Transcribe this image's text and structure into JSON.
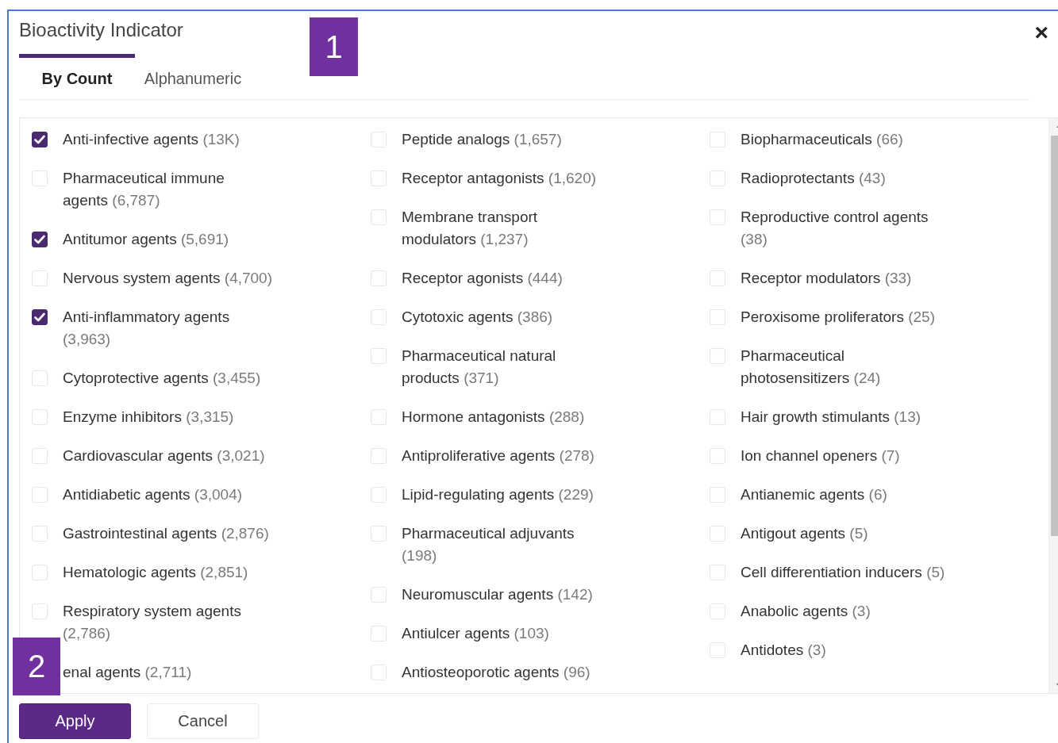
{
  "dialog": {
    "title": "Bioactivity Indicator",
    "close": "×"
  },
  "tabs": [
    {
      "label": "By Count",
      "selected": true
    },
    {
      "label": "Alphanumeric",
      "selected": false
    }
  ],
  "columns": [
    [
      {
        "name": "Anti-infective agents",
        "count": "(13K)",
        "checked": true
      },
      {
        "name": "Pharmaceutical immune agents",
        "count": "(6,787)",
        "checked": false
      },
      {
        "name": "Antitumor agents",
        "count": "(5,691)",
        "checked": true
      },
      {
        "name": "Nervous system agents",
        "count": "(4,700)",
        "checked": false
      },
      {
        "name": "Anti-inflammatory agents",
        "count": "(3,963)",
        "checked": true
      },
      {
        "name": "Cytoprotective agents",
        "count": "(3,455)",
        "checked": false
      },
      {
        "name": "Enzyme inhibitors",
        "count": "(3,315)",
        "checked": false
      },
      {
        "name": "Cardiovascular agents",
        "count": "(3,021)",
        "checked": false
      },
      {
        "name": "Antidiabetic agents",
        "count": "(3,004)",
        "checked": false
      },
      {
        "name": "Gastrointestinal agents",
        "count": "(2,876)",
        "checked": false
      },
      {
        "name": "Hematologic agents",
        "count": "(2,851)",
        "checked": false
      },
      {
        "name": "Respiratory system agents",
        "count": "(2,786)",
        "checked": false
      },
      {
        "name": "enal agents",
        "count": "(2,711)"
      }
    ],
    [
      {
        "name": "Peptide analogs",
        "count": "(1,657)",
        "checked": false
      },
      {
        "name": "Receptor antagonists",
        "count": "(1,620)",
        "checked": false
      },
      {
        "name": "Membrane transport modulators",
        "count": "(1,237)",
        "checked": false
      },
      {
        "name": "Receptor agonists",
        "count": "(444)",
        "checked": false
      },
      {
        "name": "Cytotoxic agents",
        "count": "(386)",
        "checked": false
      },
      {
        "name": "Pharmaceutical natural products",
        "count": "(371)",
        "checked": false
      },
      {
        "name": "Hormone antagonists",
        "count": "(288)",
        "checked": false
      },
      {
        "name": "Antiproliferative agents",
        "count": "(278)",
        "checked": false
      },
      {
        "name": "Lipid-regulating agents",
        "count": "(229)",
        "checked": false
      },
      {
        "name": "Pharmaceutical adjuvants",
        "count": "(198)",
        "checked": false
      },
      {
        "name": "Neuromuscular agents",
        "count": "(142)",
        "checked": false
      },
      {
        "name": "Antiulcer agents",
        "count": "(103)",
        "checked": false
      },
      {
        "name": "Antiosteoporotic agents",
        "count": "(96)",
        "checked": false
      }
    ],
    [
      {
        "name": "Biopharmaceuticals",
        "count": "(66)",
        "checked": false
      },
      {
        "name": "Radioprotectants",
        "count": "(43)",
        "checked": false
      },
      {
        "name": "Reproductive control agents",
        "count": "(38)",
        "checked": false
      },
      {
        "name": "Receptor modulators",
        "count": "(33)",
        "checked": false
      },
      {
        "name": "Peroxisome proliferators",
        "count": "(25)",
        "checked": false
      },
      {
        "name": "Pharmaceutical photosensitizers",
        "count": "(24)",
        "checked": false
      },
      {
        "name": "Hair growth stimulants",
        "count": "(13)",
        "checked": false
      },
      {
        "name": "Ion channel openers",
        "count": "(7)",
        "checked": false
      },
      {
        "name": "Antianemic agents",
        "count": "(6)",
        "checked": false
      },
      {
        "name": "Antigout agents",
        "count": "(5)",
        "checked": false
      },
      {
        "name": "Cell differentiation inducers",
        "count": "(5)",
        "checked": false
      },
      {
        "name": "Anabolic agents",
        "count": "(3)",
        "checked": false
      },
      {
        "name": "Antidotes",
        "count": "(3)",
        "checked": false
      }
    ]
  ],
  "buttons": [
    {
      "label": "Apply",
      "kind": "primary"
    },
    {
      "label": "Cancel",
      "kind": "secondary"
    }
  ],
  "callouts": [
    "1",
    "2"
  ]
}
